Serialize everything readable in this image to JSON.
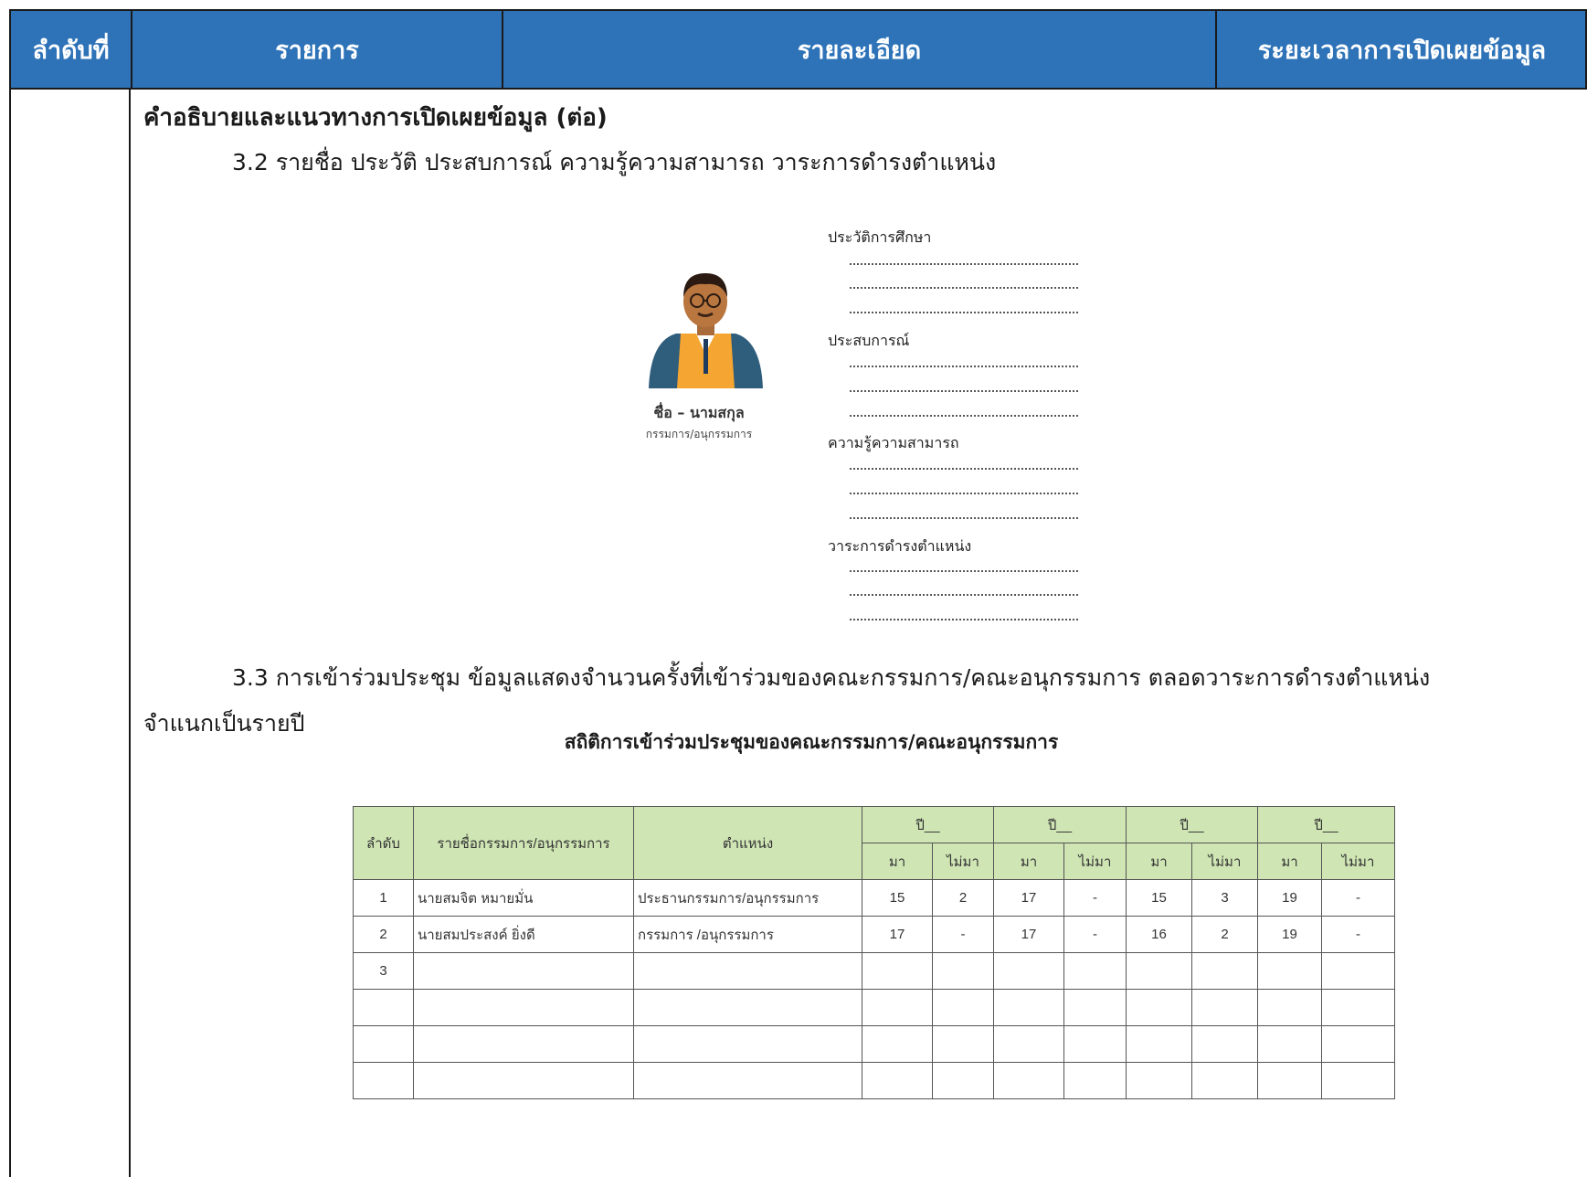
{
  "header": {
    "col1": "ลำดับที่",
    "col2": "รายการ",
    "col3": "รายละเอียด",
    "col4": "ระยะเวลาการเปิดเผยข้อมูล",
    "background_color": "#2e73b8"
  },
  "section_title": "คำอธิบายและแนวทางการเปิดเผยข้อมูล (ต่อ)",
  "item_3_2": "3.2 รายชื่อ ประวัติ ประสบการณ์ ความรู้ความสามารถ วาระการดำรงตำแหน่ง",
  "profile": {
    "name": "ชื่อ – นามสกุล",
    "role": "กรรมการ/อนุกรรมการ",
    "field_education": "ประวัติการศึกษา",
    "field_experience": "ประสบการณ์",
    "field_knowledge": "ความรู้ความสามารถ",
    "field_term": "วาระการดำรงตำแหน่ง"
  },
  "item_3_3_line1": "3.3 การเข้าร่วมประชุม ข้อมูลแสดงจำนวนครั้งที่เข้าร่วมของคณะกรรมการ/คณะอนุกรรมการ ตลอดวาระการดำรงตำแหน่ง",
  "item_3_3_line2": "จำแนกเป็นรายปี",
  "attendance": {
    "title": "สถิติการเข้าร่วมประชุมของคณะกรรมการ/คณะอนุกรรมการ",
    "header_color": "#cfe5b4",
    "col_no": "ลำดับ",
    "col_name": "รายชื่อกรรมการ/อนุกรรมการ",
    "col_position": "ตำแหน่ง",
    "years": [
      "ปี__",
      "ปี__",
      "ปี__",
      "ปี__"
    ],
    "attend": "มา",
    "absent": "ไม่มา",
    "rows": [
      {
        "no": "1",
        "name": "นายสมจิต หมายมั่น",
        "position": "ประธานกรรมการ/อนุกรรมการ",
        "values": [
          "15",
          "2",
          "17",
          "-",
          "15",
          "3",
          "19",
          "-"
        ]
      },
      {
        "no": "2",
        "name": "นายสมประสงค์ ยิ่งดี",
        "position": "กรรมการ /อนุกรรมการ",
        "values": [
          "17",
          "-",
          "17",
          "-",
          "16",
          "2",
          "19",
          "-"
        ]
      },
      {
        "no": "3",
        "name": "",
        "position": "",
        "values": [
          "",
          "",
          "",
          "",
          "",
          "",
          "",
          ""
        ]
      }
    ]
  }
}
